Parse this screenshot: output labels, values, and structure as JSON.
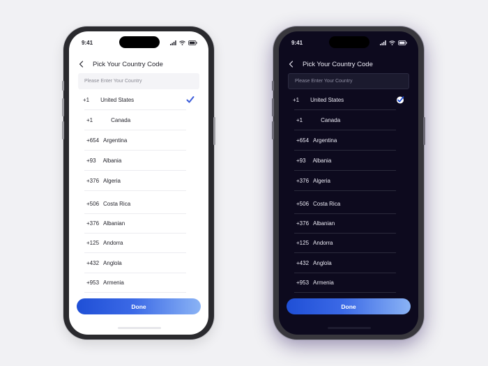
{
  "status_bar": {
    "time": "9:41"
  },
  "header": {
    "title": "Pick Your Country Code"
  },
  "search": {
    "placeholder": "Please Enter Your Country"
  },
  "countries": [
    {
      "code": "+1",
      "name": "United States",
      "selected": true
    },
    {
      "code": "+1",
      "name": "Canada",
      "selected": false
    },
    {
      "code": "+654",
      "name": "Argentina",
      "selected": false
    },
    {
      "code": "+93",
      "name": "Albania",
      "selected": false
    },
    {
      "code": "+376",
      "name": "Algeria",
      "selected": false
    },
    {
      "code": "+506",
      "name": "Costa Rica",
      "selected": false
    },
    {
      "code": "+376",
      "name": "Albanian",
      "selected": false
    },
    {
      "code": "+125",
      "name": "Andorra",
      "selected": false
    },
    {
      "code": "+432",
      "name": "Anglola",
      "selected": false
    },
    {
      "code": "+953",
      "name": "Armenia",
      "selected": false
    }
  ],
  "done_label": "Done",
  "colors": {
    "accent": "#1f4fd6",
    "accent_light": "#8ab3f5",
    "light_bg": "#ffffff",
    "dark_bg": "#0d0a1e",
    "check_light": "#3a5bd9",
    "check_dark_bg": "#ffffff"
  },
  "themes": [
    "light",
    "dark"
  ]
}
